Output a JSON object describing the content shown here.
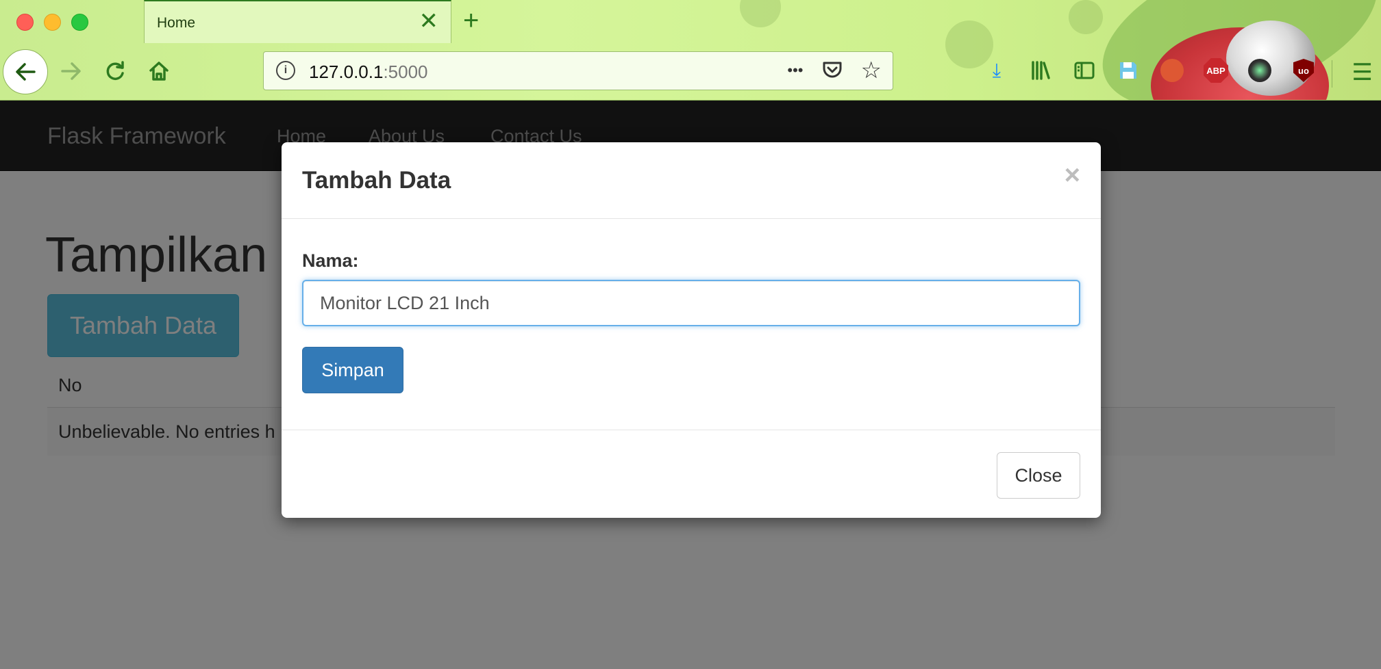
{
  "browser": {
    "tab": {
      "title": "Home",
      "close_glyph": "✕"
    },
    "new_tab_glyph": "+",
    "url": {
      "host": "127.0.0.1",
      "port": ":5000"
    },
    "icons": {
      "info": "i",
      "more": "•••",
      "pocket": "pocket-icon",
      "star": "☆",
      "download": "⤓",
      "library": "library-icon",
      "sidebar": "sidebar-icon",
      "save": "save-icon",
      "abp": "ABP",
      "ublock": "uo",
      "menu": "☰"
    }
  },
  "site": {
    "brand": "Flask Framework",
    "nav": [
      "Home",
      "About Us",
      "Contact Us"
    ],
    "heading": "Tampilkan",
    "add_button": "Tambah Data",
    "table": {
      "header_no": "No",
      "empty_message": "Unbelievable. No entries h"
    }
  },
  "modal": {
    "title": "Tambah Data",
    "close_glyph": "×",
    "field_label": "Nama:",
    "field_value": "Monitor LCD 21 Inch",
    "save_button": "Simpan",
    "close_button": "Close"
  },
  "colors": {
    "chrome_green": "#d5f59a",
    "navbar": "#222222",
    "info_button": "#5bc0de",
    "primary_button": "#337ab7",
    "input_focus": "#66afe9"
  }
}
